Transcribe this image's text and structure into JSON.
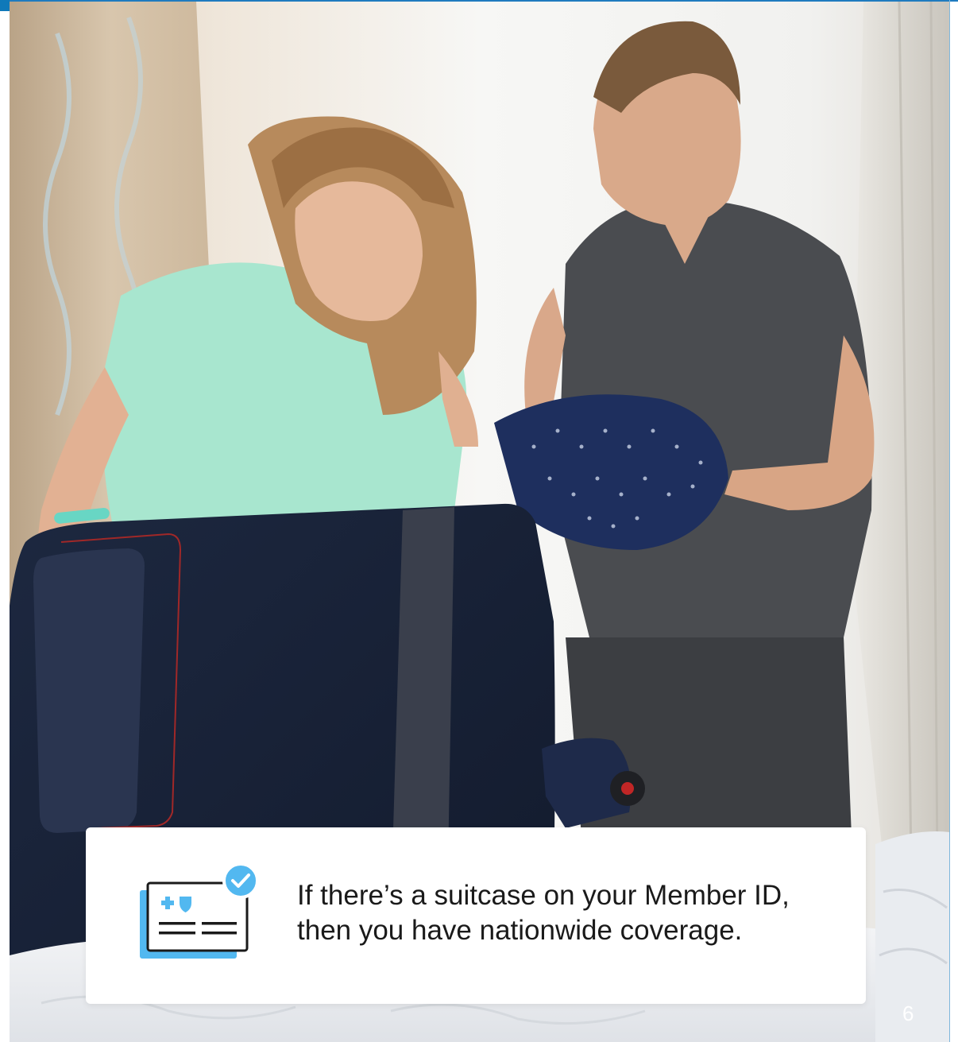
{
  "card": {
    "line1": "If there’s a suitcase on your Member ID,",
    "line2": "then you have nationwide coverage.",
    "icon": "member-id-card-check-icon"
  },
  "page_number": "6",
  "colors": {
    "accent_blue": "#52b8f0",
    "frame_blue": "#1f7bbf",
    "card_bg": "#ffffff",
    "text": "#1a1a1a"
  }
}
